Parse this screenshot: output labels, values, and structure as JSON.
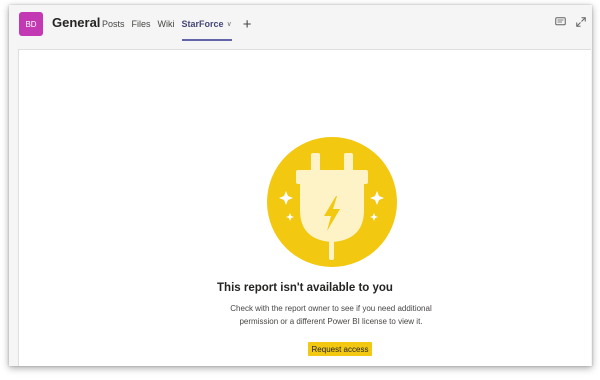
{
  "channel": {
    "avatar_initials": "BD",
    "title": "General"
  },
  "tabs": [
    {
      "label": "Posts",
      "active": false
    },
    {
      "label": "Files",
      "active": false
    },
    {
      "label": "Wiki",
      "active": false
    },
    {
      "label": "StarForce",
      "active": true
    }
  ],
  "add_tab_icon": "plus-icon",
  "header_icons": [
    "conversation-icon",
    "expand-icon"
  ],
  "message": {
    "title": "This report isn't available to you",
    "body_line1": "Check with the report owner to see if you need additional",
    "body_line2": "permission or a different Power BI license to view it.",
    "button_label": "Request access"
  },
  "colors": {
    "avatar": "#c239b3",
    "accent": "#6264a7",
    "powerbi_yellow": "#f2c811",
    "illustration_circle": "#f2c811"
  }
}
